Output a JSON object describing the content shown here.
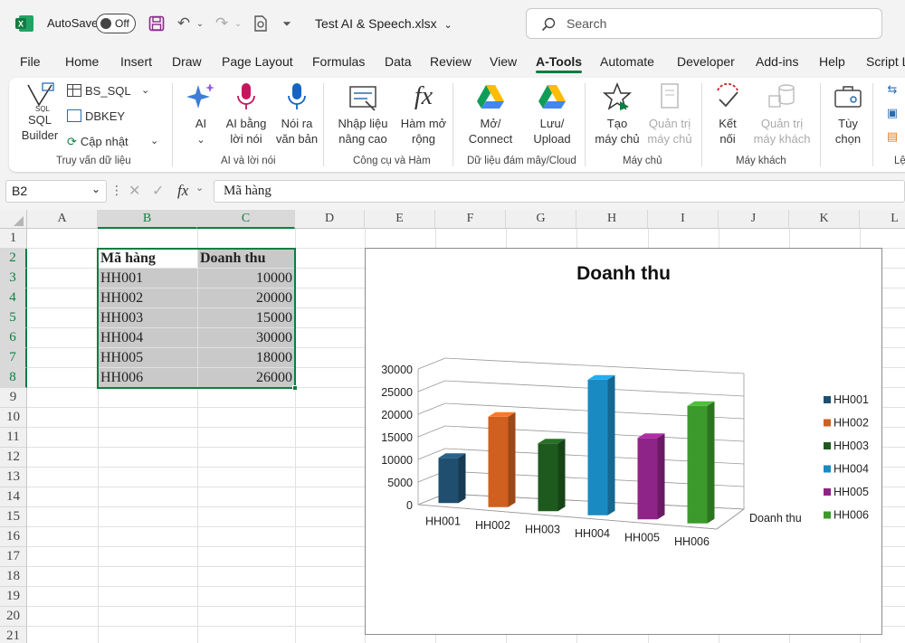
{
  "titlebar": {
    "autosave_label": "AutoSave",
    "toggle_state": "Off",
    "filename": "Test AI & Speech.xlsx",
    "search_placeholder": "Search"
  },
  "tabs": [
    "File",
    "Home",
    "Insert",
    "Draw",
    "Page Layout",
    "Formulas",
    "Data",
    "Review",
    "View",
    "A-Tools",
    "Automate",
    "Developer",
    "Add-ins",
    "Help",
    "Script L"
  ],
  "active_tab": "A-Tools",
  "ribbon": {
    "sql_builder": "SQL\nBuilder",
    "bs_sql": "BS_SQL",
    "dbkey": "DBKEY",
    "cap_nhat": "Cập nhật",
    "group1": "Truy vấn dữ liệu",
    "ai": "AI",
    "ai_bang_loi_noi": "AI bằng\nlời nói",
    "noi_ra_van_ban": "Nói ra\nvăn bản",
    "group2": "AI và lời nói",
    "nhap_lieu": "Nhập liệu\nnâng cao",
    "ham_mo_rong": "Hàm mở\nrộng",
    "group3": "Công cụ và Hàm",
    "mo_connect": "Mở/\nConnect",
    "luu_upload": "Lưu/\nUpload",
    "group4": "Dữ liệu đám mây/Cloud",
    "tao_may_chu": "Tạo\nmáy chủ",
    "quan_tri_may_chu": "Quản trị\nmáy chủ",
    "group5": "Máy chủ",
    "ket_noi": "Kết\nnối",
    "quan_tri_may_khach": "Quản trị\nmáy khách",
    "group6": "Máy khách",
    "tuy_chon": "Tùy\nchọn",
    "group7": "Lệ"
  },
  "formula_bar": {
    "name_box": "B2",
    "fx": "fx",
    "content": "Mã hàng"
  },
  "columns": [
    "A",
    "B",
    "C",
    "D",
    "E",
    "F",
    "G",
    "H",
    "I",
    "J",
    "K",
    "L"
  ],
  "rows": [
    "1",
    "2",
    "3",
    "4",
    "5",
    "6",
    "7",
    "8",
    "9",
    "10",
    "11",
    "12",
    "13",
    "14",
    "15",
    "16",
    "17",
    "18",
    "19",
    "20",
    "21"
  ],
  "table": {
    "headers": [
      "Mã hàng",
      "Doanh thu"
    ],
    "rows": [
      [
        "HH001",
        "10000"
      ],
      [
        "HH002",
        "20000"
      ],
      [
        "HH003",
        "15000"
      ],
      [
        "HH004",
        "30000"
      ],
      [
        "HH005",
        "18000"
      ],
      [
        "HH006",
        "26000"
      ]
    ]
  },
  "chart_data": {
    "type": "bar",
    "title": "Doanh thu",
    "categories": [
      "HH001",
      "HH002",
      "HH003",
      "HH004",
      "HH005",
      "HH006"
    ],
    "series": [
      {
        "name": "Doanh thu",
        "values": [
          10000,
          20000,
          15000,
          30000,
          18000,
          26000
        ]
      }
    ],
    "colors": [
      "#1f4e6e",
      "#d0601f",
      "#1e5a1e",
      "#1a8ac2",
      "#8e2488",
      "#3c9a2c"
    ],
    "yticks": [
      "30000",
      "25000",
      "20000",
      "15000",
      "10000",
      "5000",
      "0"
    ],
    "ylim": [
      0,
      30000
    ],
    "depth_label": "Doanh thu",
    "legend": [
      "HH001",
      "HH002",
      "HH003",
      "HH004",
      "HH005",
      "HH006"
    ],
    "legend_position": "right",
    "grid": true,
    "style": "3d-column"
  }
}
